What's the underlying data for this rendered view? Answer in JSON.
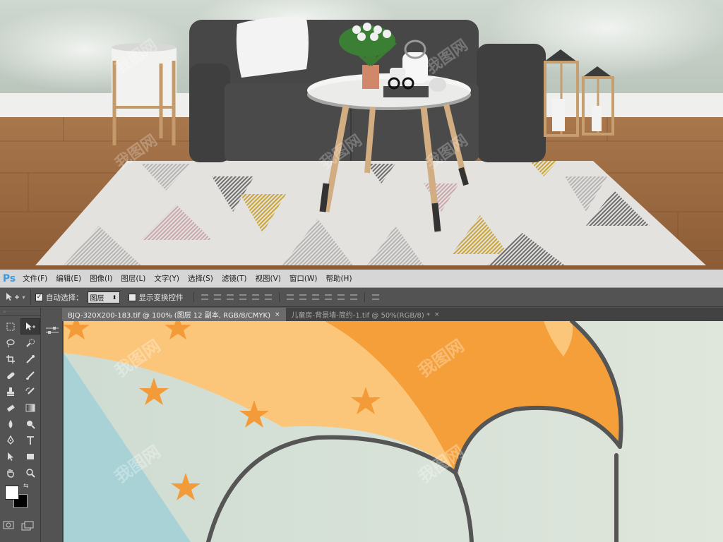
{
  "app": {
    "logo": "Ps",
    "menus": [
      "文件(F)",
      "编辑(E)",
      "图像(I)",
      "图层(L)",
      "文字(Y)",
      "选择(S)",
      "滤镜(T)",
      "视图(V)",
      "窗口(W)",
      "帮助(H)"
    ]
  },
  "options_bar": {
    "tool_icon": "move-tool-icon",
    "auto_select_checked": true,
    "auto_select_label": "自动选择：",
    "auto_select_value": "图层",
    "show_transform_checked": false,
    "show_transform_label": "显示变换控件"
  },
  "tabs": [
    {
      "label": "BJQ-320X200-183.tif @ 100% (图层 12 副本, RGB/8/CMYK)",
      "active": true,
      "close": "×"
    },
    {
      "label": "儿童房-背景墙-简约-1.tif @ 50%(RGB/8) *",
      "active": false,
      "close": "×"
    }
  ],
  "tools": [
    [
      "marquee-icon",
      "move-icon"
    ],
    [
      "lasso-icon",
      "quick-select-icon"
    ],
    [
      "crop-icon",
      "eyedropper-icon"
    ],
    [
      "healing-icon",
      "brush-icon"
    ],
    [
      "stamp-icon",
      "history-brush-icon"
    ],
    [
      "eraser-icon",
      "gradient-icon"
    ],
    [
      "blur-icon",
      "dodge-icon"
    ],
    [
      "pen-icon",
      "text-icon"
    ],
    [
      "path-select-icon",
      "shape-icon"
    ],
    [
      "hand-icon",
      "zoom-icon"
    ]
  ],
  "colors": {
    "foreground": "#ffffff",
    "background": "#000000",
    "ps_blue": "#3b9ae1",
    "umbrella_orange": "#f59f3a",
    "umbrella_light": "#fbc67a",
    "sky_blue": "#a8d2d6",
    "canvas_bg": "#d7e0d8",
    "outline": "#555555"
  },
  "watermark": "我图网"
}
